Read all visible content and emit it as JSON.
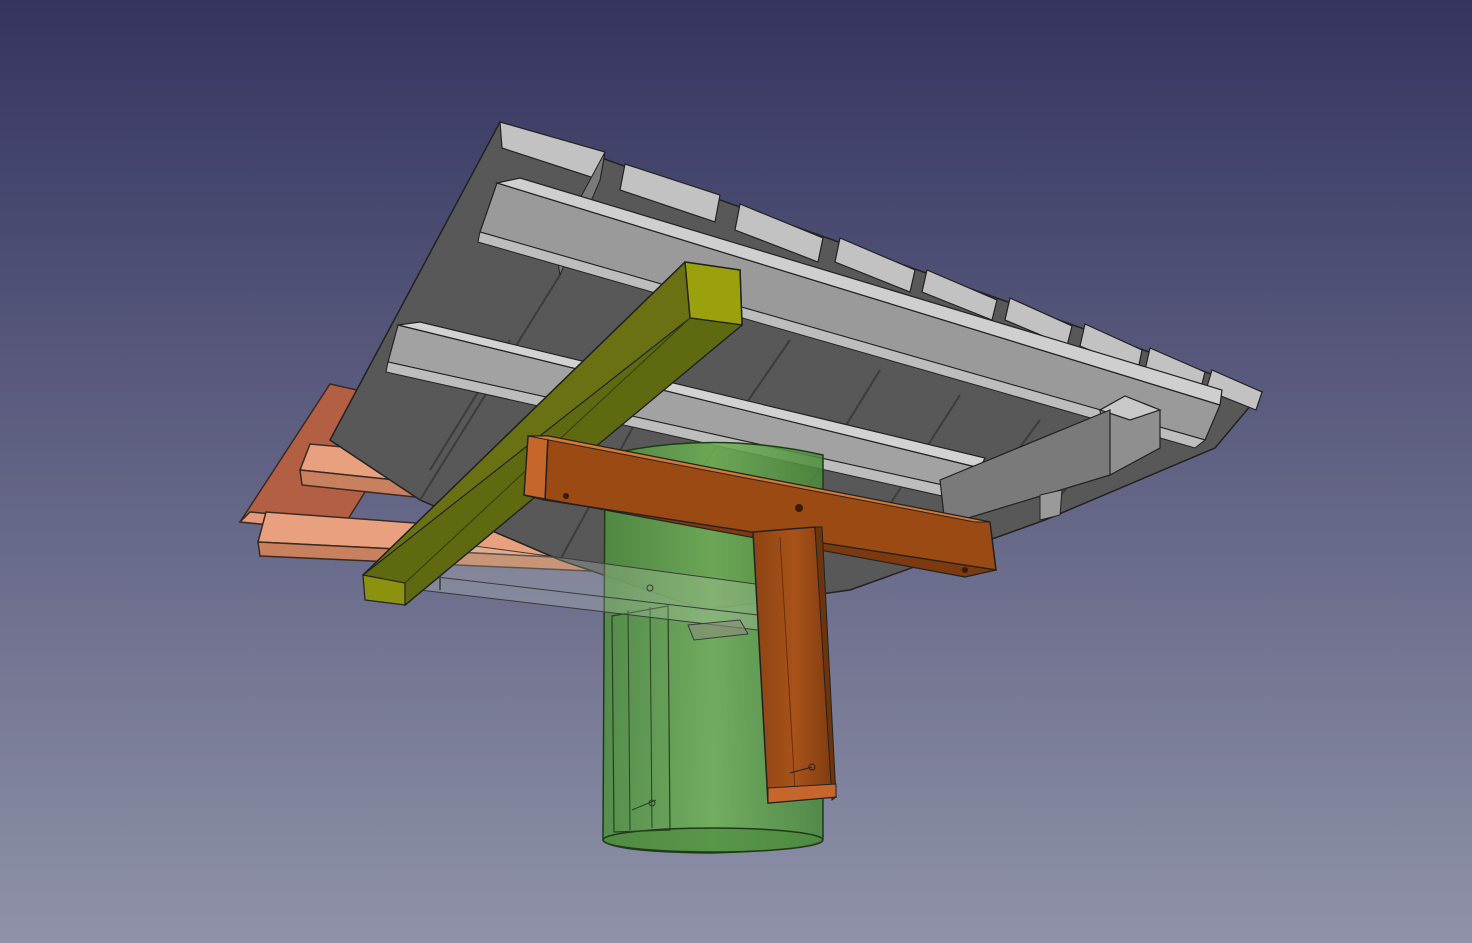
{
  "app": {
    "view": "3d-viewport"
  },
  "colors": {
    "background_top": "#34345f",
    "background_bottom": "#8f92a9",
    "deck_board_top": "#c2c2c2",
    "deck_board_side": "#8a8a8a",
    "deck_board_bottom": "#5a5a5a",
    "joist_top": "#cfcfcf",
    "joist_side": "#a2a2a2",
    "orange_beam_light": "#c7662b",
    "orange_beam_dark": "#8d4412",
    "yellow_beam_light": "#9aa10d",
    "yellow_beam_dark": "#5f6a10",
    "salmon_light": "#e8a07e",
    "salmon_dark": "#a75b40",
    "green_cylinder": "#64a64d",
    "green_cylinder_dark": "#4e8f3e"
  },
  "scene": {
    "objects": [
      {
        "name": "deck-boards",
        "kind": "solid",
        "color": "gray"
      },
      {
        "name": "deck-joists",
        "kind": "solid",
        "color": "light-gray"
      },
      {
        "name": "crossbeam",
        "kind": "solid",
        "color": "yellow-green"
      },
      {
        "name": "t-support",
        "kind": "solid",
        "color": "orange-brown"
      },
      {
        "name": "rear-rafters",
        "kind": "solid",
        "color": "salmon"
      },
      {
        "name": "post-sleeve",
        "kind": "transparent-cylinder",
        "color": "green"
      }
    ]
  }
}
